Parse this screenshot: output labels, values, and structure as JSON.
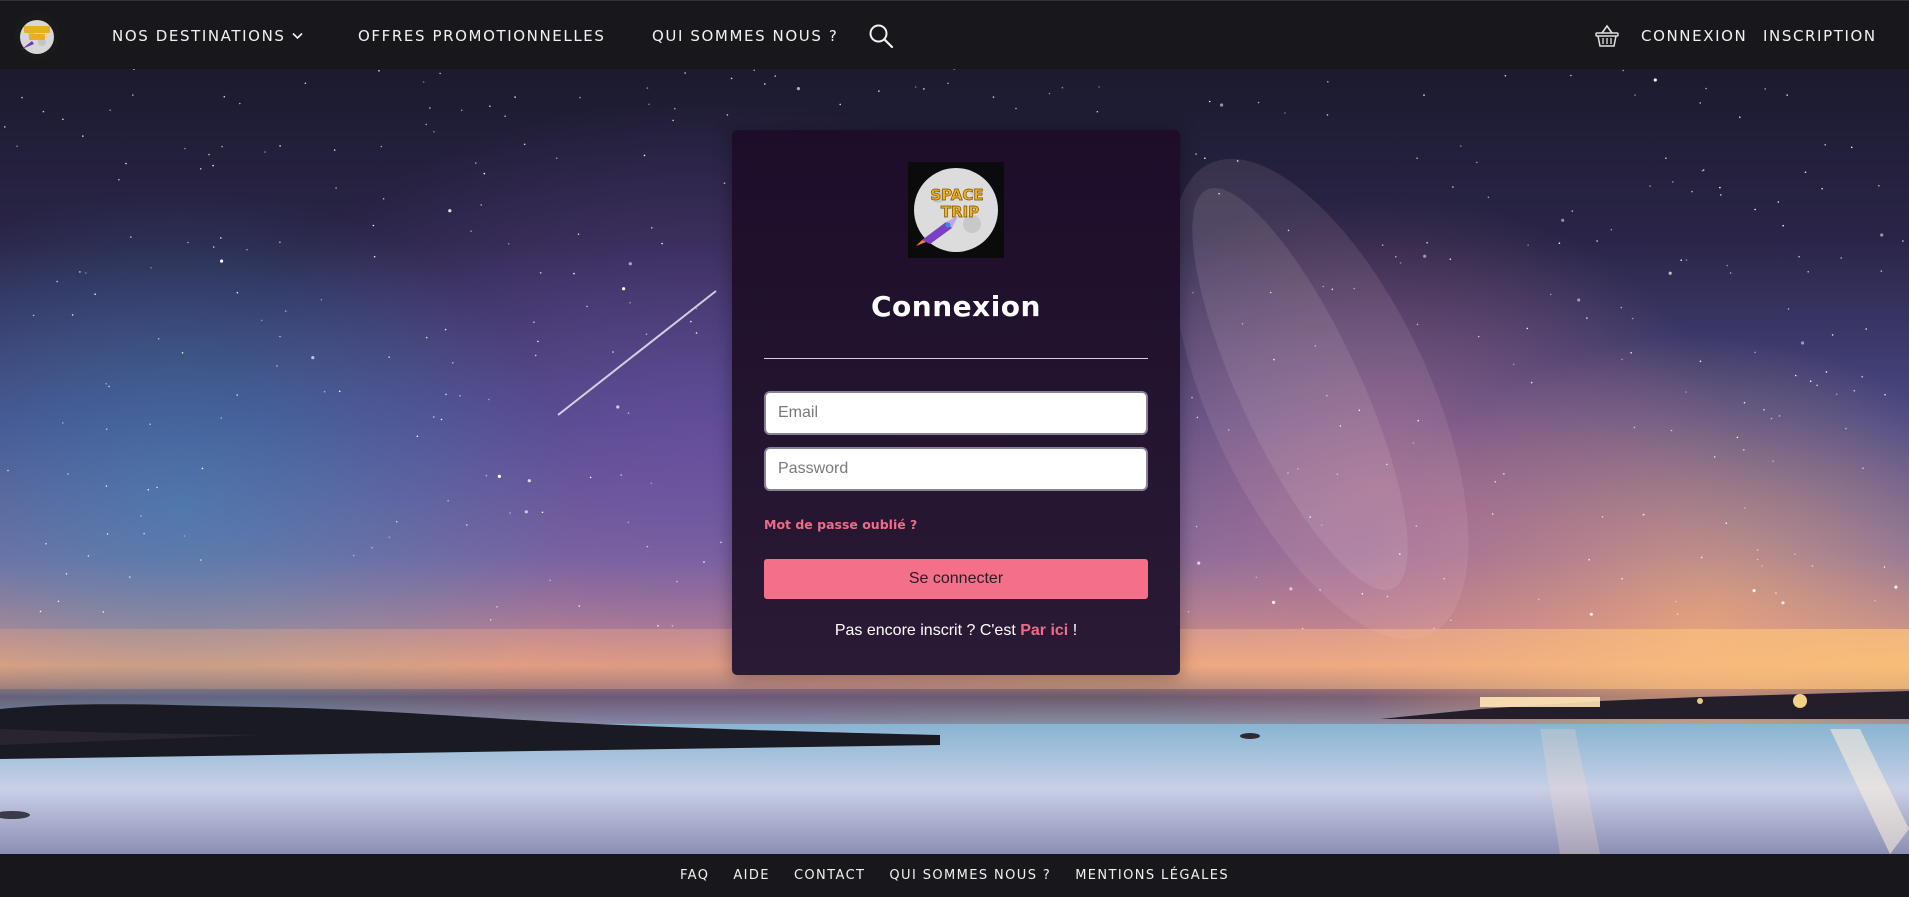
{
  "nav": {
    "brand_logo_icon": "space-trip-logo",
    "destinations_label": "Nos destinations",
    "destinations_chevron_icon": "chevron-down-icon",
    "promos_label": "Offres promotionnelles",
    "about_label": "Qui sommes nous ?",
    "search_icon": "search-icon",
    "cart_icon": "basket-icon",
    "login_label": "Connexion",
    "signup_label": "Inscription"
  },
  "login": {
    "logo_text_line1": "SPACE",
    "logo_text_line2": "TRIP",
    "title": "Connexion",
    "email_placeholder": "Email",
    "email_value": "",
    "password_placeholder": "Password",
    "password_value": "",
    "forgot_label": "Mot de passe oublié ?",
    "submit_label": "Se connecter",
    "signup_prefix": "Pas encore inscrit ? C'est ",
    "signup_link": "Par ici",
    "signup_suffix": " !"
  },
  "footer": {
    "links": [
      "FAQ",
      "Aide",
      "Contact",
      "Qui sommes nous ?",
      "Mentions légales"
    ]
  },
  "colors": {
    "navbar_bg": "#18171c",
    "card_bg": "#1d0d2a",
    "accent_pink": "#f4708a",
    "link_pink": "#f06c86",
    "text_white": "#ffffff"
  }
}
